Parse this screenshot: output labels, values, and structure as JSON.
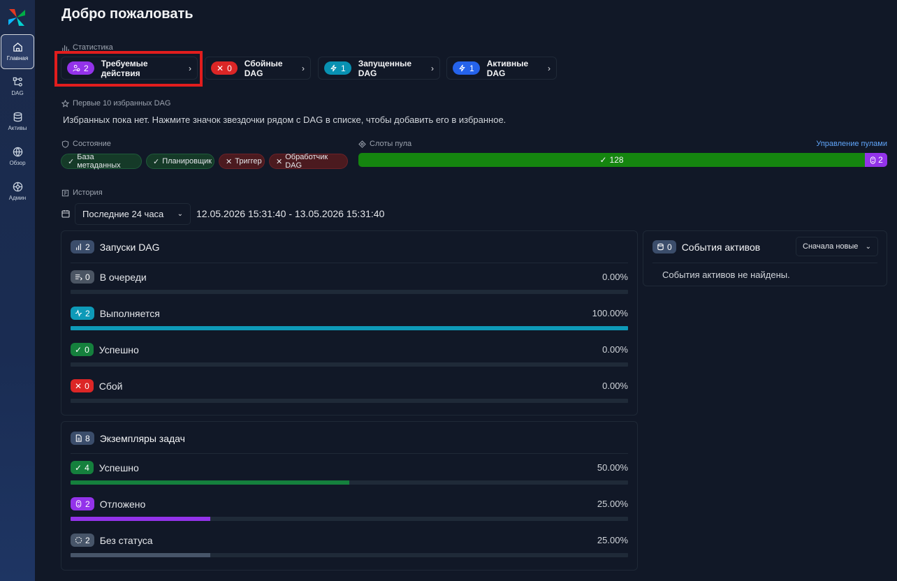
{
  "sidebar": {
    "items": [
      {
        "label": "Главная",
        "icon": "home-icon",
        "active": true
      },
      {
        "label": "DAG",
        "icon": "dag-icon",
        "active": false
      },
      {
        "label": "Активы",
        "icon": "database-icon",
        "active": false
      },
      {
        "label": "Обзор",
        "icon": "globe-icon",
        "active": false
      },
      {
        "label": "Админ",
        "icon": "settings-icon",
        "active": false
      }
    ]
  },
  "header": {
    "title": "Добро пожаловать"
  },
  "stats": {
    "label": "Статистика",
    "cards": [
      {
        "count": "2",
        "label": "Требуемые действия",
        "color": "#9333ea"
      },
      {
        "count": "0",
        "label": "Сбойные DAG",
        "color": "#dc2626"
      },
      {
        "count": "1",
        "label": "Запущенные DAG",
        "color": "#0891b2"
      },
      {
        "count": "1",
        "label": "Активные DAG",
        "color": "#2563eb"
      }
    ]
  },
  "favorites": {
    "label": "Первые 10 избранных DAG",
    "empty_text": "Избранных пока нет. Нажмите значок звездочки рядом с DAG в списке, чтобы добавить его в избранное."
  },
  "health": {
    "label": "Состояние",
    "items": [
      {
        "label": "База метаданных",
        "status": "ok"
      },
      {
        "label": "Планировщик",
        "status": "ok"
      },
      {
        "label": "Триггер",
        "status": "fail"
      },
      {
        "label": "Обработчик DAG",
        "status": "fail"
      }
    ]
  },
  "pool": {
    "label": "Слоты пула",
    "manage_link": "Управление пулами",
    "open": "128",
    "deferred": "2"
  },
  "history": {
    "label": "История",
    "period": "Последние 24 часа",
    "range": "12.05.2026 15:31:40 - 13.05.2026 15:31:40"
  },
  "dag_runs": {
    "title": "Запуски DAG",
    "count": "2",
    "rows": [
      {
        "label": "В очереди",
        "count": "0",
        "pct": "0.00%",
        "fraction": 0,
        "color": "#4b5563"
      },
      {
        "label": "Выполняется",
        "count": "2",
        "pct": "100.00%",
        "fraction": 1,
        "color": "#0e9ab8"
      },
      {
        "label": "Успешно",
        "count": "0",
        "pct": "0.00%",
        "fraction": 0,
        "color": "#15803d"
      },
      {
        "label": "Сбой",
        "count": "0",
        "pct": "0.00%",
        "fraction": 0,
        "color": "#dc2626"
      }
    ]
  },
  "task_instances": {
    "title": "Экземпляры задач",
    "count": "8",
    "rows": [
      {
        "label": "Успешно",
        "count": "4",
        "pct": "50.00%",
        "fraction": 0.5,
        "color": "#15803d"
      },
      {
        "label": "Отложено",
        "count": "2",
        "pct": "25.00%",
        "fraction": 0.25,
        "color": "#9333ea"
      },
      {
        "label": "Без статуса",
        "count": "2",
        "pct": "25.00%",
        "fraction": 0.25,
        "color": "#475569"
      }
    ]
  },
  "asset_events": {
    "title": "События активов",
    "count": "0",
    "sort": "Сначала новые",
    "empty_text": "События активов не найдены."
  }
}
